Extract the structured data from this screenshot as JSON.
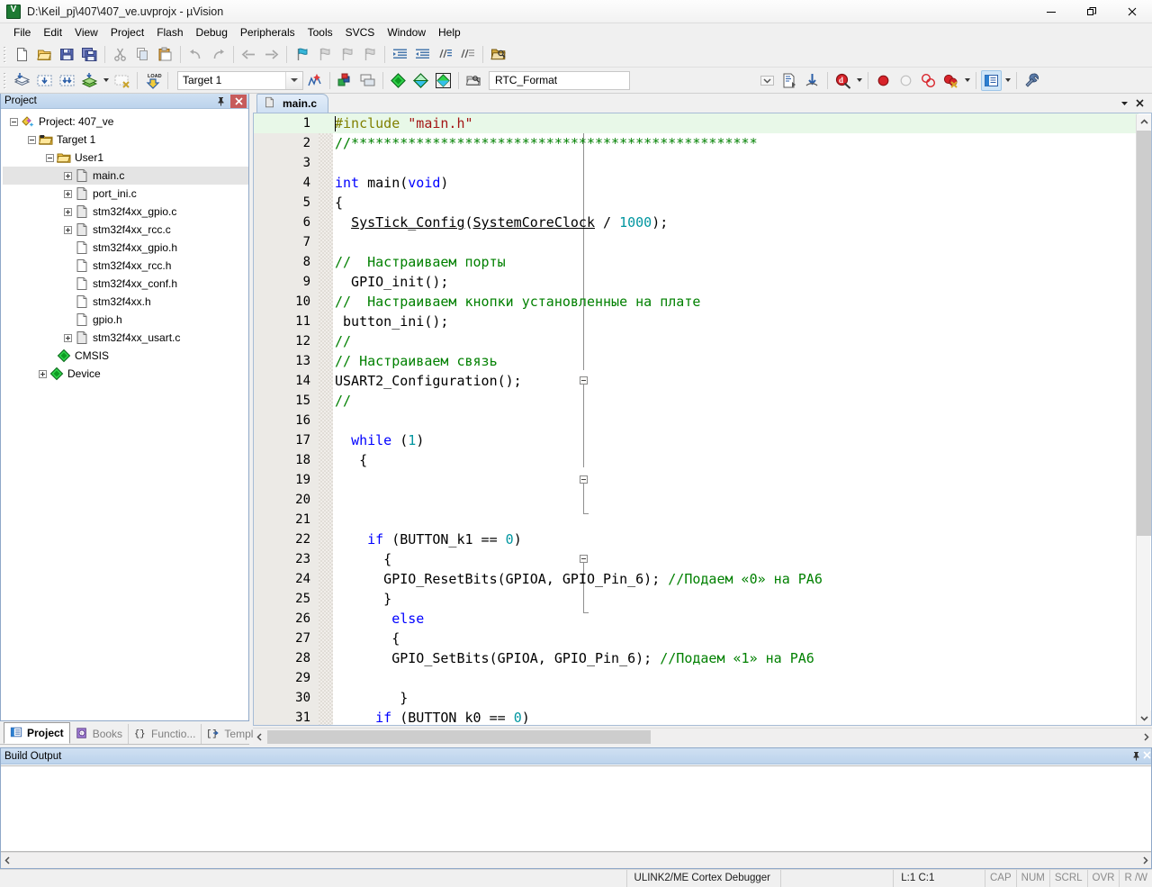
{
  "window": {
    "title": "D:\\Keil_pj\\407\\407_ve.uvprojx - µVision",
    "app_icon": "uvision-icon",
    "minimize": "–",
    "maximize": "❐",
    "close": "✕"
  },
  "menu": {
    "items": [
      "File",
      "Edit",
      "View",
      "Project",
      "Flash",
      "Debug",
      "Peripherals",
      "Tools",
      "SVCS",
      "Window",
      "Help"
    ]
  },
  "toolbar_main": {
    "items": [
      {
        "name": "new-file-icon",
        "title": "New"
      },
      {
        "name": "open-file-icon",
        "title": "Open"
      },
      {
        "name": "save-icon",
        "title": "Save"
      },
      {
        "name": "save-all-icon",
        "title": "Save All"
      },
      {
        "name": "cut-icon",
        "title": "Cut"
      },
      {
        "name": "copy-icon",
        "title": "Copy"
      },
      {
        "name": "paste-icon",
        "title": "Paste"
      },
      {
        "name": "undo-icon",
        "title": "Undo"
      },
      {
        "name": "redo-icon",
        "title": "Redo"
      },
      {
        "name": "navigate-back-icon",
        "title": "Back"
      },
      {
        "name": "navigate-forward-icon",
        "title": "Forward"
      },
      {
        "name": "bookmark-toggle-icon",
        "title": "Insert/Remove Bookmark"
      },
      {
        "name": "bookmark-prev-icon",
        "title": "Previous Bookmark"
      },
      {
        "name": "bookmark-next-icon",
        "title": "Next Bookmark"
      },
      {
        "name": "bookmark-clear-icon",
        "title": "Clear All Bookmarks"
      },
      {
        "name": "indent-icon",
        "title": "Indent"
      },
      {
        "name": "outdent-icon",
        "title": "Outdent"
      },
      {
        "name": "comment-icon",
        "title": "Comment"
      },
      {
        "name": "uncomment-icon",
        "title": "Uncomment"
      },
      {
        "name": "find-in-files-icon",
        "title": "Find in Files"
      }
    ]
  },
  "toolbar_build": {
    "items": [
      {
        "name": "translate-icon",
        "title": "Translate"
      },
      {
        "name": "build-icon",
        "title": "Build"
      },
      {
        "name": "rebuild-icon",
        "title": "Rebuild"
      },
      {
        "name": "batch-build-icon",
        "title": "Batch Build"
      },
      {
        "name": "stop-build-icon",
        "title": "Stop Build"
      },
      {
        "name": "download-icon",
        "title": "Download"
      }
    ],
    "target_value": "Target 1",
    "target_dropdown_icon": "chevron-down-icon",
    "manage_project_icon": "manage-project-items-icon",
    "target_options_icon": "options-for-target-icon",
    "manage_multi_icon": "multi-project-icon",
    "pack_installer_icon": "pack-installer-icon",
    "manage_rte_icon": "manage-rte-icon",
    "run_env_icon": "run-environment-icon",
    "rtc_value": "RTC_Format",
    "rtc_dropdown_icon": "chevron-down-icon",
    "insert_icon": "insert-file-icon",
    "goto_icon": "goto-definition-icon",
    "debug_icon": "start-debug-icon",
    "bp_set_icon": "insert-breakpoint-icon",
    "bp_dis_icon": "disable-breakpoint-icon",
    "bp_all_icon": "disable-all-breakpoints-icon",
    "bp_kill_icon": "kill-all-breakpoints-icon",
    "window_icon": "project-window-icon",
    "config_icon": "configuration-wrench-icon"
  },
  "project_panel": {
    "title": "Project",
    "pin_icon": "pin-icon",
    "close_icon": "close-icon",
    "tree": [
      {
        "label": "Project: 407_ve",
        "indent": 0,
        "expander": "minus",
        "icon": "project-icon"
      },
      {
        "label": "Target 1",
        "indent": 1,
        "expander": "minus",
        "icon": "target-folder-icon"
      },
      {
        "label": "User1",
        "indent": 2,
        "expander": "minus",
        "icon": "group-folder-icon"
      },
      {
        "label": "main.c",
        "indent": 3,
        "expander": "plus",
        "icon": "c-file-icon",
        "selected": true
      },
      {
        "label": "port_ini.c",
        "indent": 3,
        "expander": "plus",
        "icon": "c-file-icon"
      },
      {
        "label": "stm32f4xx_gpio.c",
        "indent": 3,
        "expander": "plus",
        "icon": "c-file-icon"
      },
      {
        "label": "stm32f4xx_rcc.c",
        "indent": 3,
        "expander": "plus",
        "icon": "c-file-icon"
      },
      {
        "label": "stm32f4xx_gpio.h",
        "indent": 3,
        "expander": "none",
        "icon": "h-file-icon"
      },
      {
        "label": "stm32f4xx_rcc.h",
        "indent": 3,
        "expander": "none",
        "icon": "h-file-icon"
      },
      {
        "label": "stm32f4xx_conf.h",
        "indent": 3,
        "expander": "none",
        "icon": "h-file-icon"
      },
      {
        "label": "stm32f4xx.h",
        "indent": 3,
        "expander": "none",
        "icon": "h-file-icon"
      },
      {
        "label": "gpio.h",
        "indent": 3,
        "expander": "none",
        "icon": "h-file-icon"
      },
      {
        "label": "stm32f4xx_usart.c",
        "indent": 3,
        "expander": "plus",
        "icon": "c-file-icon"
      },
      {
        "label": "CMSIS",
        "indent": 2,
        "expander": "none",
        "icon": "component-icon"
      },
      {
        "label": "Device",
        "indent": 2,
        "expander": "plus",
        "icon": "component-icon"
      }
    ]
  },
  "panel_tabs": [
    {
      "label": "Project",
      "icon": "project-window-icon",
      "active": true
    },
    {
      "label": "Books",
      "icon": "books-icon",
      "active": false
    },
    {
      "label": "Functio...",
      "icon": "functions-icon",
      "active": false
    },
    {
      "label": "Templa...",
      "icon": "templates-icon",
      "active": false
    }
  ],
  "editor": {
    "tabs": [
      {
        "label": "main.c",
        "icon": "c-file-icon",
        "active": true
      }
    ],
    "tab_dropdown_icon": "chevron-down-icon",
    "tab_close_icon": "close-icon",
    "caret_line": 1,
    "lines": [
      {
        "n": 1,
        "highlight": true,
        "fold": "none",
        "tokens": [
          {
            "t": "#include ",
            "c": "pre"
          },
          {
            "t": "\"main.h\"",
            "c": "str"
          }
        ]
      },
      {
        "n": 2,
        "fold": "none",
        "tokens": [
          {
            "t": "//**************************************************",
            "c": "cmt"
          }
        ]
      },
      {
        "n": 3,
        "fold": "none",
        "tokens": []
      },
      {
        "n": 4,
        "fold": "none",
        "tokens": [
          {
            "t": "int",
            "c": "kw"
          },
          {
            "t": " main(",
            "c": ""
          },
          {
            "t": "void",
            "c": "kw"
          },
          {
            "t": ")",
            "c": ""
          }
        ]
      },
      {
        "n": 5,
        "fold": "start",
        "tokens": [
          {
            "t": "{",
            "c": ""
          }
        ]
      },
      {
        "n": 6,
        "fold": "bar",
        "tokens": [
          {
            "t": "  ",
            "c": ""
          },
          {
            "t": "SysTick_Config",
            "c": "fn"
          },
          {
            "t": "(",
            "c": ""
          },
          {
            "t": "SystemCoreClock",
            "c": "fn"
          },
          {
            "t": " / ",
            "c": ""
          },
          {
            "t": "1000",
            "c": "num"
          },
          {
            "t": ");",
            "c": ""
          }
        ]
      },
      {
        "n": 7,
        "fold": "bar",
        "tokens": []
      },
      {
        "n": 8,
        "fold": "bar",
        "tokens": [
          {
            "t": "//  Настраиваем порты",
            "c": "cmt"
          }
        ]
      },
      {
        "n": 9,
        "fold": "bar",
        "tokens": [
          {
            "t": "  GPIO_init();",
            "c": ""
          }
        ]
      },
      {
        "n": 10,
        "fold": "bar",
        "tokens": [
          {
            "t": "//  Настраиваем кнопки установленные на плате",
            "c": "cmt"
          }
        ]
      },
      {
        "n": 11,
        "fold": "bar",
        "tokens": [
          {
            "t": " button_ini();",
            "c": ""
          }
        ]
      },
      {
        "n": 12,
        "fold": "bar",
        "tokens": [
          {
            "t": "//",
            "c": "cmt"
          }
        ]
      },
      {
        "n": 13,
        "fold": "bar",
        "tokens": [
          {
            "t": "// Настраиваем связь",
            "c": "cmt"
          }
        ]
      },
      {
        "n": 14,
        "fold": "bar",
        "tokens": [
          {
            "t": "USART2_Configuration();",
            "c": ""
          }
        ]
      },
      {
        "n": 15,
        "fold": "bar",
        "tokens": [
          {
            "t": "//",
            "c": "cmt"
          }
        ]
      },
      {
        "n": 16,
        "fold": "bar",
        "tokens": []
      },
      {
        "n": 17,
        "fold": "bar",
        "tokens": [
          {
            "t": "  ",
            "c": ""
          },
          {
            "t": "while",
            "c": "kw"
          },
          {
            "t": " (",
            "c": ""
          },
          {
            "t": "1",
            "c": "num"
          },
          {
            "t": ")",
            "c": ""
          }
        ]
      },
      {
        "n": 18,
        "fold": "start2",
        "tokens": [
          {
            "t": "   {",
            "c": ""
          }
        ]
      },
      {
        "n": 19,
        "fold": "bar2",
        "tokens": []
      },
      {
        "n": 20,
        "fold": "bar2",
        "tokens": []
      },
      {
        "n": 21,
        "fold": "bar2",
        "tokens": []
      },
      {
        "n": 22,
        "fold": "bar2",
        "tokens": [
          {
            "t": "    ",
            "c": ""
          },
          {
            "t": "if",
            "c": "kw"
          },
          {
            "t": " (BUTTON_k1 == ",
            "c": ""
          },
          {
            "t": "0",
            "c": "num"
          },
          {
            "t": ")",
            "c": ""
          }
        ]
      },
      {
        "n": 23,
        "fold": "start3",
        "tokens": [
          {
            "t": "      {",
            "c": ""
          }
        ]
      },
      {
        "n": 24,
        "fold": "bar3",
        "tokens": [
          {
            "t": "      GPIO_ResetBits(GPIOA, GPIO_Pin_6); ",
            "c": ""
          },
          {
            "t": "//Подаем «0» на РА6",
            "c": "cmt"
          }
        ]
      },
      {
        "n": 25,
        "fold": "end3",
        "tokens": [
          {
            "t": "      }",
            "c": ""
          }
        ]
      },
      {
        "n": 26,
        "fold": "none",
        "tokens": [
          {
            "t": "       ",
            "c": ""
          },
          {
            "t": "else",
            "c": "kw"
          }
        ]
      },
      {
        "n": 27,
        "fold": "start4",
        "tokens": [
          {
            "t": "       {",
            "c": ""
          }
        ]
      },
      {
        "n": 28,
        "fold": "bar4",
        "tokens": [
          {
            "t": "       GPIO_SetBits(GPIOA, GPIO_Pin_6); ",
            "c": ""
          },
          {
            "t": "//Подаем «1» на РА6",
            "c": "cmt"
          }
        ]
      },
      {
        "n": 29,
        "fold": "bar4",
        "tokens": []
      },
      {
        "n": 30,
        "fold": "end4",
        "tokens": [
          {
            "t": "        }",
            "c": ""
          }
        ]
      },
      {
        "n": 31,
        "fold": "none",
        "tokens": [
          {
            "t": "     ",
            "c": ""
          },
          {
            "t": "if",
            "c": "kw"
          },
          {
            "t": " (BUTTON_k0 == ",
            "c": ""
          },
          {
            "t": "0",
            "c": "num"
          },
          {
            "t": ")",
            "c": ""
          }
        ]
      }
    ]
  },
  "build_output": {
    "title": "Build Output",
    "pin_icon": "pin-icon",
    "close_icon": "close-icon",
    "text": ""
  },
  "statusbar": {
    "message": "",
    "debugger": "ULINK2/ME Cortex Debugger",
    "extra": "",
    "position": "L:1 C:1",
    "indicators": [
      "CAP",
      "NUM",
      "SCRL",
      "OVR",
      "R /W"
    ]
  },
  "colors": {
    "accent": "#bcd3ec",
    "tab_active": "#cfe0f3",
    "keyword": "#0000ff",
    "comment": "#008000",
    "string": "#a31515",
    "number": "#0096a0",
    "preprocessor": "#808000",
    "current_line": "#e8f8e8"
  }
}
